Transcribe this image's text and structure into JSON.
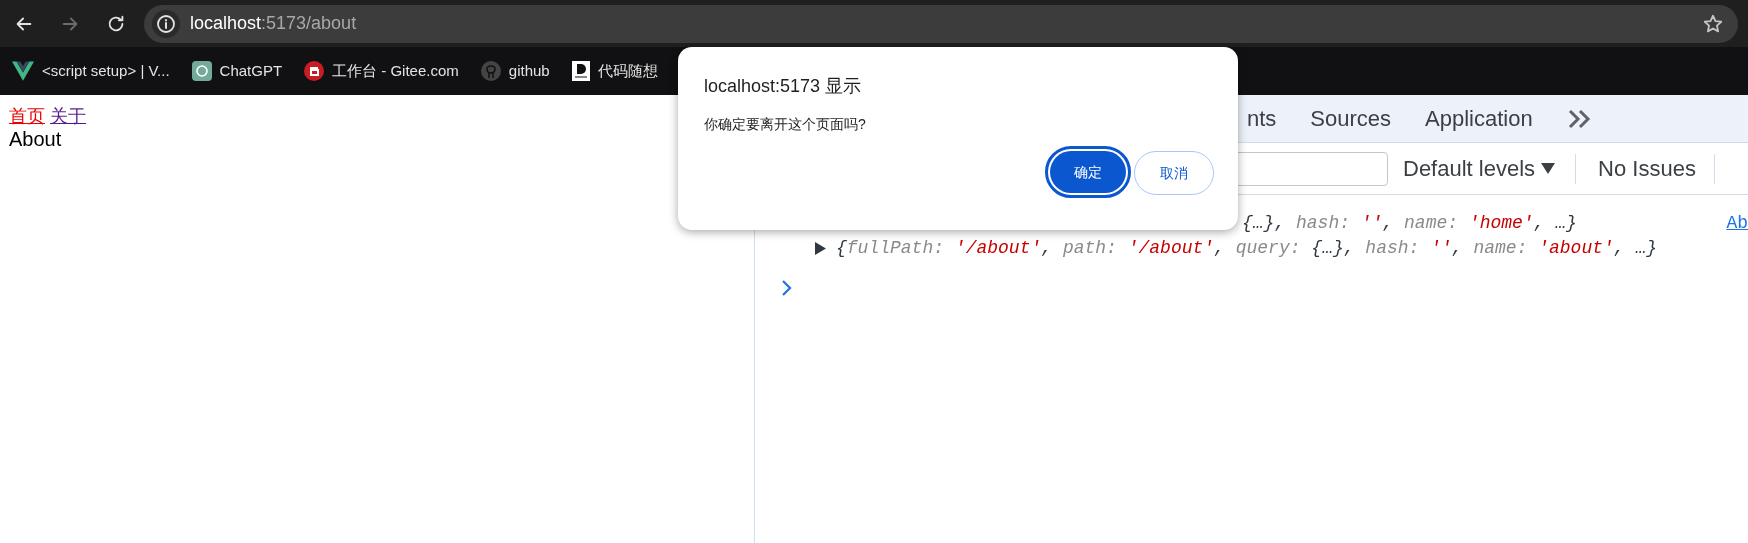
{
  "browser": {
    "nav_buttons": [
      {
        "kind": "back",
        "disabled": false
      },
      {
        "kind": "forward",
        "disabled": true
      },
      {
        "kind": "reload",
        "disabled": false
      }
    ],
    "address": {
      "host": "localhost",
      "rest": ":5173/about"
    },
    "bookmarks": [
      {
        "kind": "vue",
        "label": "<script setup> | V..."
      },
      {
        "kind": "chatgpt",
        "label": "ChatGPT"
      },
      {
        "kind": "gitee",
        "label": "工作台 - Gitee.com"
      },
      {
        "kind": "github",
        "label": "github"
      },
      {
        "kind": "doc",
        "label": "代码随想"
      }
    ]
  },
  "page": {
    "links": [
      {
        "label": "首页",
        "color": "#ee0000"
      },
      {
        "label": "关于",
        "color": "#551a8b"
      }
    ],
    "heading": "About"
  },
  "devtools": {
    "tabs": [
      {
        "label": "nts"
      },
      {
        "label": "Sources"
      },
      {
        "label": "Application"
      }
    ],
    "toolbar": {
      "levels": "Default levels",
      "issues": "No Issues"
    },
    "console": [
      {
        "kind": "partial",
        "segments": [
          {
            "kind": "plain",
            "text": "{…}, "
          },
          {
            "kind": "key",
            "text": "hash: "
          },
          {
            "kind": "string",
            "text": "''"
          },
          {
            "kind": "plain",
            "text": ", "
          },
          {
            "kind": "key",
            "text": "name: "
          },
          {
            "kind": "string",
            "text": "'home'"
          },
          {
            "kind": "plain",
            "text": ",  …}"
          }
        ],
        "link": "Ab"
      },
      {
        "kind": "object",
        "segments": [
          {
            "kind": "plain",
            "text": "{"
          },
          {
            "kind": "key",
            "text": "fullPath: "
          },
          {
            "kind": "string",
            "text": "'/about'"
          },
          {
            "kind": "plain",
            "text": ", "
          },
          {
            "kind": "key",
            "text": "path: "
          },
          {
            "kind": "string",
            "text": "'/about'"
          },
          {
            "kind": "plain",
            "text": ", "
          },
          {
            "kind": "key",
            "text": "query: "
          },
          {
            "kind": "plain",
            "text": "{…}, "
          },
          {
            "kind": "key",
            "text": "hash: "
          },
          {
            "kind": "string",
            "text": "''"
          },
          {
            "kind": "plain",
            "text": ", "
          },
          {
            "kind": "key",
            "text": "name: "
          },
          {
            "kind": "string",
            "text": "'about'"
          },
          {
            "kind": "plain",
            "text": ",  …}"
          }
        ]
      }
    ]
  },
  "dialog": {
    "title": "localhost:5173 显示",
    "message": "你确定要离开这个页面吗?",
    "buttons": [
      {
        "kind": "primary",
        "label": "确定"
      },
      {
        "kind": "secondary",
        "label": "取消"
      }
    ]
  }
}
